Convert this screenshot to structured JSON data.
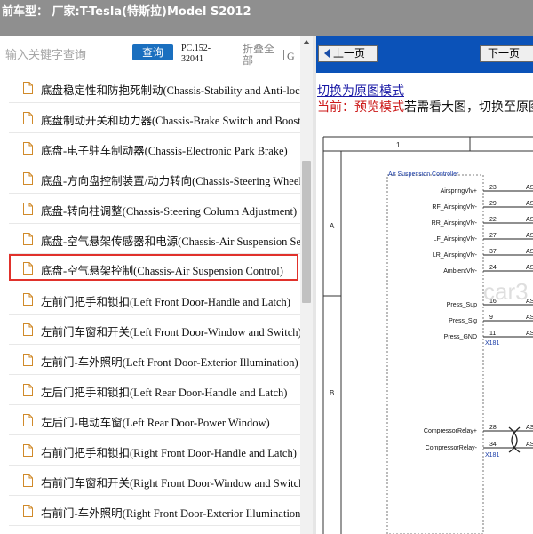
{
  "titlebar": {
    "title": "前车型：  厂家:T-Tesla(特斯拉)Model S2012"
  },
  "search": {
    "placeholder": "输入关键字查询",
    "query_label": "查询",
    "pc_code": "PC.152-32041",
    "collapse_all_label": "折叠全部",
    "g_letter": "G"
  },
  "tree": {
    "items": [
      {
        "label": "底盘稳定性和防抱死制动(Chassis-Stability and Anti-lock"
      },
      {
        "label": "底盘制动开关和助力器(Chassis-Brake Switch and Booster)"
      },
      {
        "label": "底盘-电子驻车制动器(Chassis-Electronic Park Brake)"
      },
      {
        "label": "底盘-方向盘控制装置/动力转向(Chassis-Steering Wheel"
      },
      {
        "label": "底盘-转向柱调整(Chassis-Steering Column Adjustment)"
      },
      {
        "label": "底盘-空气悬架传感器和电源(Chassis-Air Suspension Sensors"
      },
      {
        "label": "底盘-空气悬架控制(Chassis-Air Suspension Control)"
      },
      {
        "label": "左前门把手和锁扣(Left Front Door-Handle and Latch)"
      },
      {
        "label": "左前门车窗和开关(Left Front Door-Window and Switch)"
      },
      {
        "label": "左前门-车外照明(Left Front Door-Exterior Illumination)"
      },
      {
        "label": "左后门把手和锁扣(Left Rear Door-Handle and Latch)"
      },
      {
        "label": "左后门-电动车窗(Left Rear Door-Power Window)"
      },
      {
        "label": "右前门把手和锁扣(Right Front Door-Handle and Latch)"
      },
      {
        "label": "右前门车窗和开关(Right Front Door-Window and Switch)"
      },
      {
        "label": "右前门-车外照明(Right Front Door-Exterior Illumination)"
      }
    ],
    "selected_index": 6
  },
  "viewer": {
    "prev_label": "上一页",
    "next_label": "下一页",
    "switch_link": "切换为原图模式",
    "current_label": "当前：预览模式",
    "hint": "若需看大图，切换至原图模式"
  },
  "diagram": {
    "column_number": "1",
    "row_a": "A",
    "row_b": "B",
    "module_title": "Air Suspension Controller",
    "watermark": "car3",
    "pins": [
      {
        "name": "AirspringVlv+",
        "pin": "23",
        "dest": "AS"
      },
      {
        "name": "RF_AirspingVlv-",
        "pin": "29",
        "dest": "AS"
      },
      {
        "name": "RR_AirspingVlv-",
        "pin": "22",
        "dest": "AS"
      },
      {
        "name": "LF_AirspingVlv-",
        "pin": "27",
        "dest": "AS"
      },
      {
        "name": "LR_AirspingVlv-",
        "pin": "37",
        "dest": "AS"
      },
      {
        "name": "AmbientVlv-",
        "pin": "24",
        "dest": "AS"
      },
      {
        "name": "Press_Sup",
        "pin": "16",
        "dest": "AS"
      },
      {
        "name": "Press_Sig",
        "pin": "9",
        "dest": "AS"
      },
      {
        "name": "Press_GND",
        "pin": "11",
        "dest": "AS"
      },
      {
        "name": "CompressorRelay+",
        "pin": "28",
        "dest": "AS"
      },
      {
        "name": "CompressorRelay-",
        "pin": "34",
        "dest": "AS"
      }
    ],
    "connector_1": "X181",
    "connector_2": "X181"
  },
  "colors": {
    "titlebar": "#8f8f8f",
    "navbar": "#0b52b8",
    "query_button": "#1a6fbf",
    "selected_border": "#e0312b",
    "link": "#1a1aa6",
    "current_mode": "#cc1a1a"
  },
  "icons": {
    "tree_item": "file-icon",
    "prev": "left-arrow-icon"
  }
}
